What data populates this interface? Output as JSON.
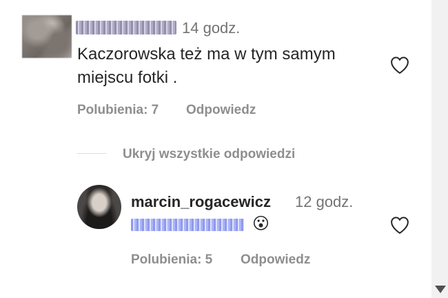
{
  "comment": {
    "username": "",
    "time": "14 godz.",
    "text": "Kaczorowska też ma w tym samym miejscu fotki .",
    "likes": "Polubienia: 7",
    "reply_label": "Odpowiedz"
  },
  "hide_replies_label": "Ukryj wszystkie odpowiedzi",
  "reply": {
    "username": "marcin_rogacewicz",
    "time": "12 godz.",
    "emoji": "😮",
    "likes": "Polubienia: 5",
    "reply_label": "Odpowiedz"
  },
  "icons": {
    "like": "heart-outline-icon",
    "scroll": "scroll-down-arrow-icon"
  },
  "colors": {
    "text": "#262626",
    "secondary": "#8e8e8e",
    "time": "#737373"
  }
}
